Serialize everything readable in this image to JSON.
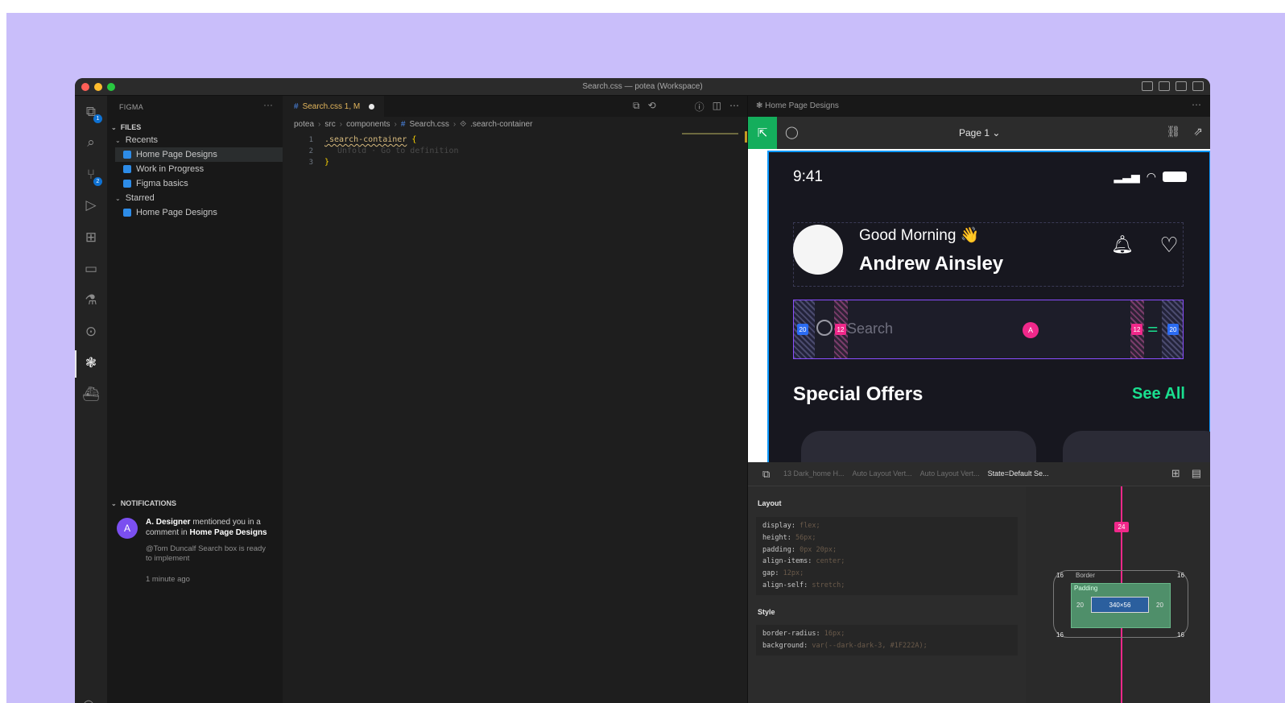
{
  "window": {
    "title": "Search.css — potea (Workspace)"
  },
  "activity_bar": {
    "explorer_badge": "1",
    "scm_badge": "2"
  },
  "sidebar": {
    "header": "FIGMA",
    "more": "···",
    "files_title": "FILES",
    "recents_title": "Recents",
    "recents": [
      "Home Page Designs",
      "Work in Progress",
      "Figma basics"
    ],
    "starred_title": "Starred",
    "starred": [
      "Home Page Designs"
    ],
    "notifications_title": "NOTIFICATIONS",
    "notification": {
      "avatar_letter": "A",
      "author": "A. Designer",
      "text_mid": " mentioned you in a comment in ",
      "file": "Home Page Designs",
      "message": "@Tom Duncalf Search box is ready to implement",
      "time": "1 minute ago"
    }
  },
  "editor": {
    "tab_label": "Search.css 1, M",
    "breadcrumb": [
      "potea",
      "src",
      "components",
      "Search.css",
      ".search-container"
    ],
    "lines": [
      "1",
      "2",
      "3"
    ],
    "code_selector": ".search-container",
    "open_brace": "{",
    "close_brace": "}",
    "ghost_text": "Unfold · Go to definition"
  },
  "figma": {
    "tab_label": "Home Page Designs",
    "page_label": "Page 1 ⌄",
    "phone": {
      "time": "9:41",
      "greeting": "Good Morning 👋",
      "name": "Andrew Ainsley",
      "search_placeholder": "Search",
      "padding_left": "20",
      "gap_left": "12",
      "gap_right": "12",
      "padding_right": "20",
      "center_marker": "A",
      "section_title": "Special Offers",
      "see_all": "See All"
    },
    "inspect": {
      "crumbs": [
        "13 Dark_home H...",
        "Auto Layout Vert...",
        "Auto Layout Vert...",
        "State=Default Se..."
      ],
      "layout_title": "Layout",
      "layout_css": [
        {
          "prop": "display:",
          "val": " flex;"
        },
        {
          "prop": "height:",
          "val": " 56px;"
        },
        {
          "prop": "padding:",
          "val": " 0px 20px;"
        },
        {
          "prop": "align-items:",
          "val": " center;"
        },
        {
          "prop": "gap:",
          "val": " 12px;"
        },
        {
          "prop": "align-self:",
          "val": " stretch;"
        }
      ],
      "style_title": "Style",
      "style_css": [
        {
          "prop": "border-radius:",
          "val": " 16px;"
        },
        {
          "prop": "background:",
          "val": " var(--dark-dark-3, #1F222A);"
        }
      ],
      "box": {
        "top_spacing": "24",
        "border_label": "Border",
        "corner_tl": "16",
        "corner_tr": "16",
        "corner_bl": "16",
        "corner_br": "16",
        "padding_label": "Padding",
        "padding_left": "20",
        "padding_right": "20",
        "content_size": "340×56"
      }
    }
  },
  "colors": {
    "background": "#c9befa",
    "figma_green": "#14ae5c",
    "accent_pink": "#f0288a",
    "accent_green": "#1adf8f"
  }
}
